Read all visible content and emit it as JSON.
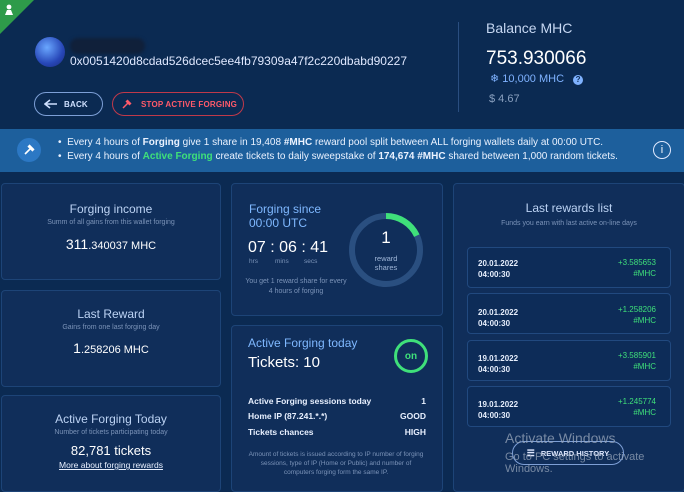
{
  "header": {
    "wallet_address": "0x0051420d8cdad526dcec5ee4fb79309a47f2c220dbabd90227",
    "back_label": "BACK",
    "stop_label": "STOP ACTIVE FORGING"
  },
  "balance": {
    "title": "Balance MHC",
    "value": "753.930066",
    "mhc": "10,000 MHC",
    "usd": "$ 4.67"
  },
  "banner": {
    "line1_pre": "Every 4 hours of ",
    "line1_bold": "Forging",
    "line1_mid": " give 1 share in 19,408 ",
    "line1_bold2": "#MHC",
    "line1_post": " reward pool split between ALL forging wallets daily at 00:00 UTC.",
    "line2_pre": "Every 4 hours of ",
    "line2_green": "Active Forging",
    "line2_mid": " create tickets to daily sweepstake of ",
    "line2_bold": "174,674 #MHC",
    "line2_post": " shared between 1,000 random tickets."
  },
  "income": {
    "title": "Forging income",
    "sub": "Summ of all gains from this wallet forging",
    "value_int": "311",
    "value_dec": ".340037 MHC"
  },
  "last_reward": {
    "title": "Last Reward",
    "sub": "Gains from one last forging day",
    "value_int": "1",
    "value_dec": ".258206 MHC"
  },
  "active_today": {
    "title": "Active Forging Today",
    "sub": "Number of tickets participating today",
    "value": "82,781 tickets",
    "link": "More about forging rewards"
  },
  "forging_since": {
    "title": "Forging since",
    "time": "00:00 UTC",
    "hrs": "07",
    "mins": "06",
    "secs": "41",
    "hrs_label": "hrs",
    "mins_label": "mins",
    "secs_label": "secs",
    "note": "You get 1 reward share for every 4 hours of forging",
    "shares_value": "1",
    "shares_label1": "reward",
    "shares_label2": "shares",
    "shares_progress": 0.18
  },
  "active_forging": {
    "title": "Active Forging today",
    "tickets": "Tickets: 10",
    "toggle": "on",
    "rows": [
      {
        "label": "Active Forging sessions today",
        "value": "1"
      },
      {
        "label": "Home IP (87.241.*.*)",
        "value": "GOOD"
      },
      {
        "label": "Tickets chances",
        "value": "HIGH"
      }
    ],
    "note": "Amount of tickets is issued according to IP number of forging sessions, type of IP (Home or Public) and number of computers forging form the same IP."
  },
  "rewards_list": {
    "title": "Last rewards list",
    "sub": "Funds you earn with last active on-line days",
    "items": [
      {
        "date": "20.01.2022",
        "time": "04:00:30",
        "amount": "+3.585653",
        "unit": "#MHC"
      },
      {
        "date": "20.01.2022",
        "time": "04:00:30",
        "amount": "+1.258206",
        "unit": "#MHC"
      },
      {
        "date": "19.01.2022",
        "time": "04:00:30",
        "amount": "+3.585901",
        "unit": "#MHC"
      },
      {
        "date": "19.01.2022",
        "time": "04:00:30",
        "amount": "+1.245774",
        "unit": "#MHC"
      }
    ],
    "history_label": "REWARD HISTORY"
  },
  "watermark": {
    "line1": "Activate Windows",
    "line2": "Go to PC settings to activate Windows."
  },
  "colors": {
    "accent_green": "#3fe07a",
    "danger": "#ff5a6a",
    "panel": "#102e5a",
    "banner": "#1d5f9c"
  }
}
